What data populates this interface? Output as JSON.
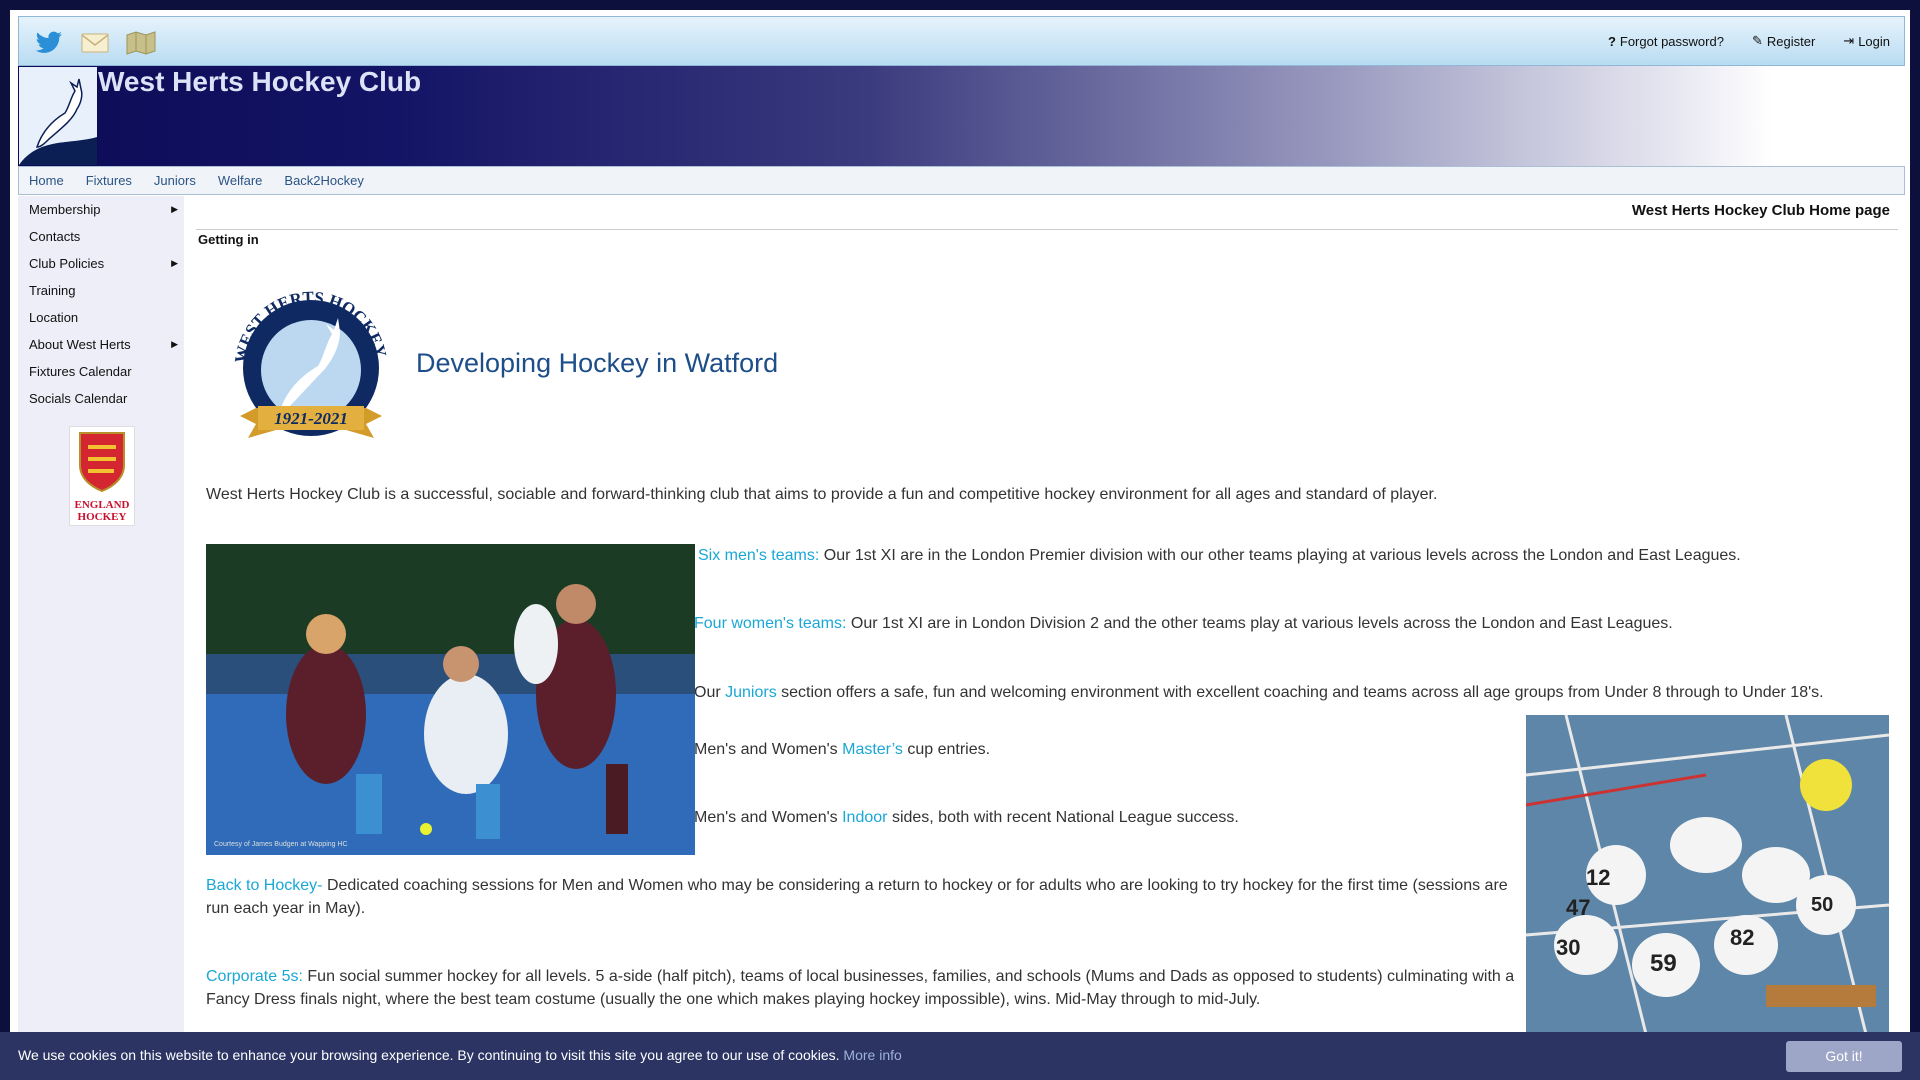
{
  "topbar": {
    "icons": [
      "twitter-icon",
      "envelope-icon",
      "map-icon"
    ],
    "forgot_label": "Forgot password?",
    "register_label": "Register",
    "login_label": "Login"
  },
  "banner": {
    "site_title": "West Herts Hockey Club"
  },
  "mainnav": {
    "items": [
      {
        "label": "Home"
      },
      {
        "label": "Fixtures"
      },
      {
        "label": "Juniors"
      },
      {
        "label": "Welfare"
      },
      {
        "label": "Back2Hockey"
      }
    ]
  },
  "sidebar": {
    "items": [
      {
        "label": "Membership",
        "has_submenu": true
      },
      {
        "label": "Contacts",
        "has_submenu": false
      },
      {
        "label": "Club Policies",
        "has_submenu": true
      },
      {
        "label": "Training",
        "has_submenu": false
      },
      {
        "label": "Location",
        "has_submenu": false
      },
      {
        "label": "About West Herts",
        "has_submenu": true
      },
      {
        "label": "Fixtures Calendar",
        "has_submenu": false
      },
      {
        "label": "Socials Calendar",
        "has_submenu": false
      }
    ],
    "badge_text_1": "ENGLAND",
    "badge_text_2": "HOCKEY"
  },
  "content": {
    "page_heading": "West Herts Hockey Club Home page",
    "section_heading": "Getting in",
    "logo_text": "WEST HERTS HOCKEY CLUB",
    "logo_years": "1921-2021",
    "tagline": "Developing Hockey in Watford",
    "intro": "West Herts Hockey Club is a successful, sociable and forward-thinking club that aims to provide a fun and competitive hockey environment for all ages and standard of player.",
    "photo1_caption": "Courtesy of James Budgen at Wapping HC",
    "photo2_numbers": [
      "12",
      "47",
      "30",
      "59",
      "82",
      "50"
    ],
    "mens": {
      "link": "Six men's teams:",
      "text": "Our 1st XI are in the London Premier division with our other teams playing at various levels across the London and East Leagues."
    },
    "womens": {
      "link": "Four women's teams:",
      "text": "Our 1st XI are in London Division 2 and the other teams play at various levels across the London and East Leagues."
    },
    "juniors": {
      "before": "Our",
      "link": "Juniors",
      "text": "section offers a safe, fun and welcoming environment with excellent coaching and teams across all age groups from Under 8 through to Under 18's."
    },
    "masters": {
      "before": "Men's and Women's",
      "link": "Master’s",
      "text": "cup entries."
    },
    "indoor": {
      "before": "Men's and Women's",
      "link": "Indoor",
      "text": "sides, both with recent National League success."
    },
    "back": {
      "link": "Back to Hockey-",
      "text": "Dedicated coaching sessions for Men and Women who may be considering a return to hockey or for adults who are looking to try hockey for the first time (sessions are run each year in May)."
    },
    "corporate": {
      "link": "Corporate 5s:",
      "text": "Fun social summer hockey for all levels. 5 a-side (half pitch), teams of local businesses, families, and schools (Mums and Dads as opposed to students) culminating with a Fancy Dress finals night, where the best team costume (usually the one which makes playing hockey impossible), wins.  Mid-May through to mid-July."
    }
  },
  "cookie": {
    "message": "We use cookies on this website to enhance your browsing experience. By continuing to visit this site you agree to our use of cookies.",
    "more_info": "More info",
    "button": "Got it!"
  },
  "colors": {
    "banner_dark": "#0b0b55",
    "link": "#1aa7d6",
    "tagline": "#1d4e89",
    "nav_link": "#2b5384",
    "cookie_bg": "#2b3463"
  }
}
